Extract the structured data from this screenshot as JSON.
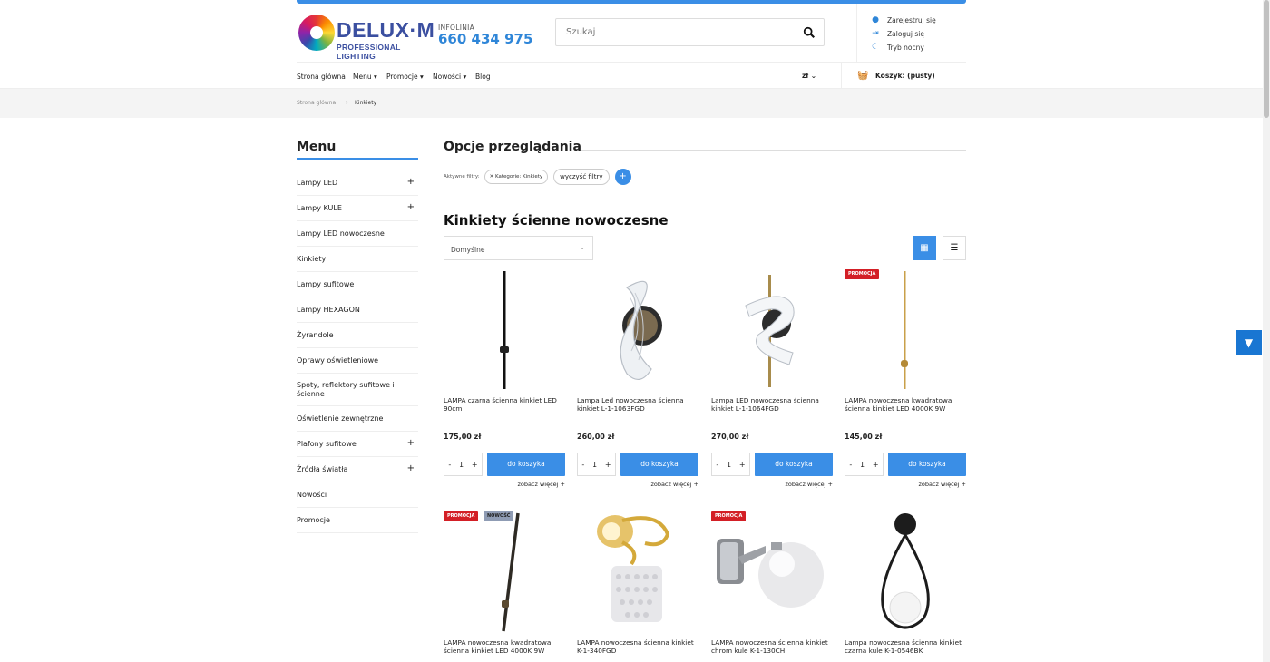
{
  "logo": {
    "brand": "DELUX·M",
    "tagline": "PROFESSIONAL LIGHTING"
  },
  "hotline": {
    "label": "INFOLINIA",
    "phone": "660 434 975"
  },
  "search": {
    "placeholder": "Szukaj"
  },
  "user_actions": [
    {
      "label": "Zarejestruj się",
      "icon": "user-icon"
    },
    {
      "label": "Zaloguj się",
      "icon": "login-icon"
    },
    {
      "label": "Tryb nocny",
      "icon": "moon-icon"
    }
  ],
  "nav": {
    "items": [
      "Strona główna",
      "Menu",
      "Promocje",
      "Nowości",
      "Blog"
    ],
    "currency": "zł",
    "cart_label": "Koszyk: (pusty)"
  },
  "breadcrumb": {
    "home": "Strona główna",
    "current": "Kinkiety"
  },
  "sidebar": {
    "title": "Menu",
    "items": [
      {
        "label": "Lampy LED",
        "expandable": true
      },
      {
        "label": "Lampy KULE",
        "expandable": true
      },
      {
        "label": "Lampy LED nowoczesne",
        "expandable": false
      },
      {
        "label": "Kinkiety",
        "expandable": false
      },
      {
        "label": "Lampy sufitowe",
        "expandable": false
      },
      {
        "label": "Lampy HEXAGON",
        "expandable": false
      },
      {
        "label": "Żyrandole",
        "expandable": false
      },
      {
        "label": "Oprawy oświetleniowe",
        "expandable": false
      },
      {
        "label": "Spoty, reflektory sufitowe i ścienne",
        "expandable": false
      },
      {
        "label": "Oświetlenie zewnętrzne",
        "expandable": false
      },
      {
        "label": "Plafony sufitowe",
        "expandable": true
      },
      {
        "label": "Źródła światła",
        "expandable": true
      },
      {
        "label": "Nowości",
        "expandable": false
      },
      {
        "label": "Promocje",
        "expandable": false
      }
    ]
  },
  "browse": {
    "title": "Opcje przeglądania",
    "active_filters_label": "Aktywne filtry:",
    "filter_chip": "Kategorie: Kinkiety",
    "clear_filters": "wyczyść filtry",
    "add": "+"
  },
  "listing": {
    "title": "Kinkiety ścienne nowoczesne",
    "sort_value": "Domyślne"
  },
  "products": [
    {
      "name": "LAMPA czarna ścienna kinkiet LED 90cm",
      "price": "175,00 zł",
      "badges": [],
      "img": "black-bar"
    },
    {
      "name": "Lampa Led nowoczesna ścienna kinkiet L-1-1063FGD",
      "price": "260,00 zł",
      "badges": [],
      "img": "crystal-swirl"
    },
    {
      "name": "Lampa LED nowoczesna ścienna kinkiet L-1-1064FGD",
      "price": "270,00 zł",
      "badges": [],
      "img": "acrylic-swirl"
    },
    {
      "name": "LAMPA nowoczesna kwadratowa ścienna kinkiet LED 4000K 9W",
      "price": "145,00 zł",
      "badges": [
        "PROMOCJA"
      ],
      "img": "gold-bar"
    },
    {
      "name": "LAMPA nowoczesna kwadratowa ścienna kinkiet LED 4000K 9W",
      "price": "",
      "badges": [
        "PROMOCJA",
        "NOWOŚĆ"
      ],
      "img": "diag-bar"
    },
    {
      "name": "LAMPA nowoczesna ścienna kinkiet K-1-340FGD",
      "price": "",
      "badges": [],
      "img": "gold-crystal"
    },
    {
      "name": "LAMPA nowoczesna ścienna kinkiet chrom kule K-1-130CH",
      "price": "",
      "badges": [
        "PROMOCJA"
      ],
      "img": "chrome-globe"
    },
    {
      "name": "Lampa nowoczesna ścienna kinkiet czarna kule K-1-0546BK",
      "price": "",
      "badges": [],
      "img": "black-drop"
    }
  ],
  "product_actions": {
    "qty": "1",
    "minus": "-",
    "plus": "+",
    "add_to_cart": "do koszyka",
    "see_more": "zobacz więcej +"
  }
}
